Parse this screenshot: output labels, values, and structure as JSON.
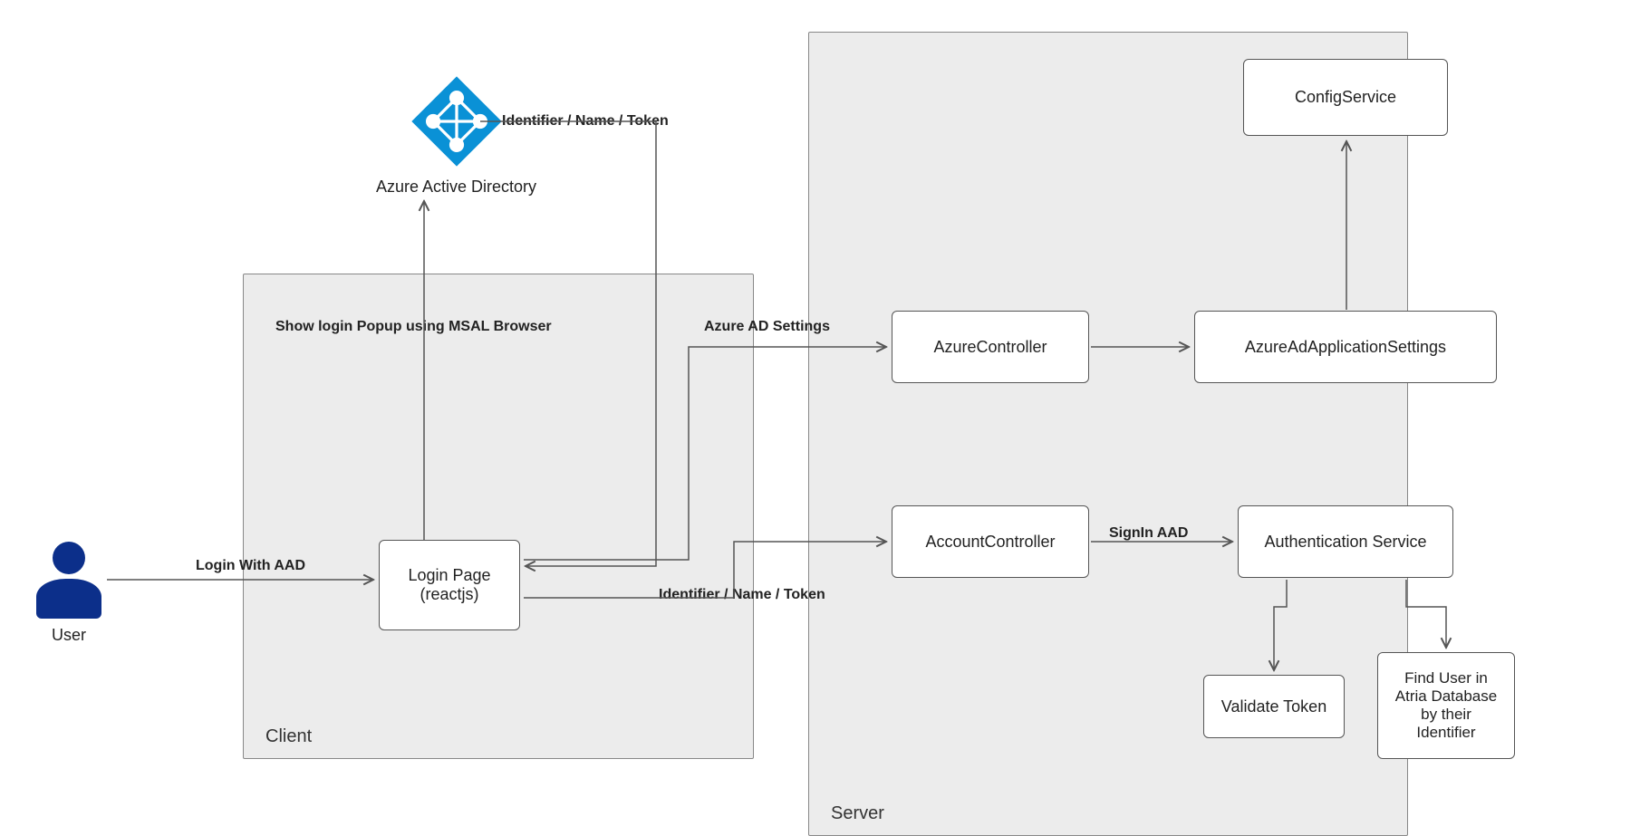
{
  "actors": {
    "user": "User",
    "aad": "Azure Active Directory"
  },
  "containers": {
    "client": "Client",
    "server": "Server"
  },
  "nodes": {
    "login_page_line1": "Login Page",
    "login_page_line2": "(reactjs)",
    "azure_controller": "AzureController",
    "account_controller": "AccountController",
    "config_service": "ConfigService",
    "aad_settings": "AzureAdApplicationSettings",
    "auth_service": "Authentication Service",
    "validate_token": "Validate Token",
    "find_user_line1": "Find User in",
    "find_user_line2": "Atria Database",
    "find_user_line3": "by their",
    "find_user_line4": "Identifier"
  },
  "edges": {
    "login_with_aad": "Login With AAD",
    "show_login_popup": "Show login Popup using MSAL Browser",
    "identifier_name_token_top": "Identifier / Name / Token",
    "identifier_name_token_bottom": "Identifier / Name / Token",
    "azure_ad_settings": "Azure AD Settings",
    "signin_aad": "SignIn AAD"
  },
  "colors": {
    "azure_blue": "#0a91d6",
    "user_blue": "#0c2f8a",
    "container_bg": "#ececec",
    "arrow": "#555555"
  }
}
